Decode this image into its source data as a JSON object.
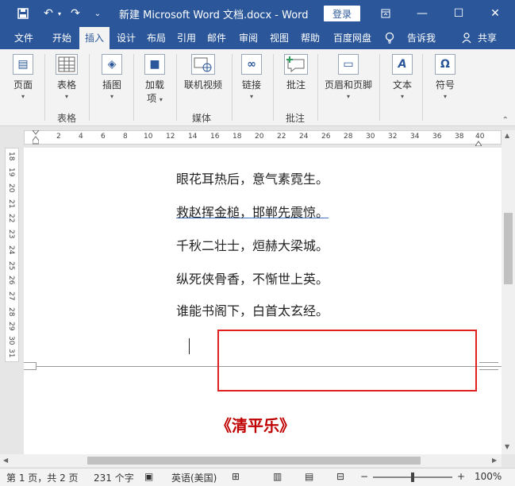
{
  "titlebar": {
    "title": "新建 Microsoft Word 文档.docx  -  Word",
    "login": "登录"
  },
  "tabs": [
    {
      "label": "文件"
    },
    {
      "label": "开始"
    },
    {
      "label": "插入"
    },
    {
      "label": "设计"
    },
    {
      "label": "布局"
    },
    {
      "label": "引用"
    },
    {
      "label": "邮件"
    },
    {
      "label": "审阅"
    },
    {
      "label": "视图"
    },
    {
      "label": "帮助"
    },
    {
      "label": "百度网盘"
    },
    {
      "label": "告诉我"
    },
    {
      "label": "共享"
    }
  ],
  "ribbon": {
    "page": "页面",
    "table": "表格",
    "table_group": "表格",
    "illustrations": "插图",
    "addins_line1": "加载",
    "addins_line2": "项",
    "online_video": "联机视频",
    "media_group": "媒体",
    "link": "链接",
    "comment": "批注",
    "comment_group": "批注",
    "header_footer": "页眉和页脚",
    "text": "文本",
    "symbol": "符号"
  },
  "ruler": {
    "h_ticks": [
      "2",
      "4",
      "6",
      "8",
      "10",
      "12",
      "14",
      "16",
      "18",
      "20",
      "22",
      "24",
      "26",
      "28",
      "30",
      "32",
      "34",
      "36",
      "38",
      "40"
    ],
    "v_ticks": [
      "18",
      "19",
      "20",
      "21",
      "22",
      "23",
      "24",
      "25",
      "26",
      "27",
      "28",
      "29",
      "30",
      "31"
    ]
  },
  "document": {
    "lines": [
      "眼花耳热后，意气素霓生。",
      "救赵挥金槌，邯郸先震惊。",
      "千秋二壮士，烜赫大梁城。",
      "纵死侠骨香，不惭世上英。",
      "谁能书阁下，白首太玄经。"
    ],
    "heading": "《清平乐》"
  },
  "status": {
    "page": "第 1 页，共 2 页",
    "words": "231 个字",
    "language": "英语(美国)",
    "zoom": "100%"
  },
  "colors": {
    "brand": "#2b579a",
    "highlight": "#e02020",
    "heading": "#c00000"
  }
}
